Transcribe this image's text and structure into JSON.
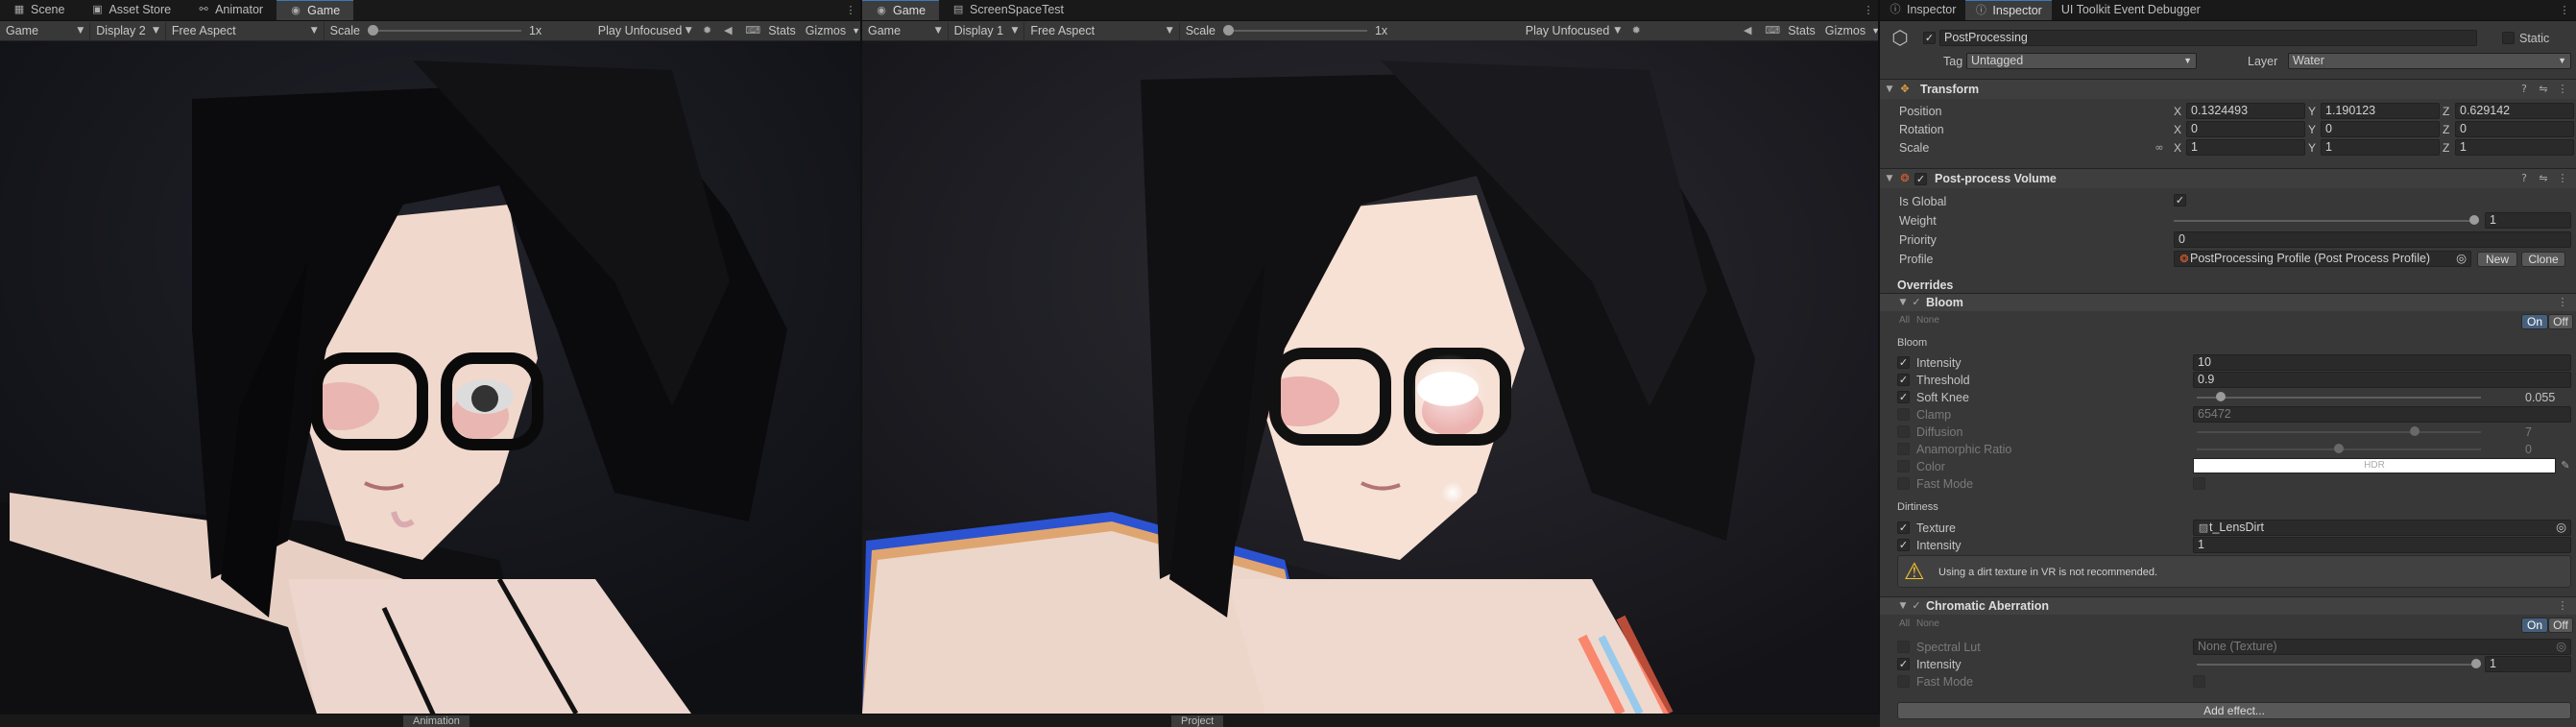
{
  "left_panel": {
    "tabs": [
      {
        "icon": "scene-icon",
        "label": "Scene"
      },
      {
        "icon": "asset-store-icon",
        "label": "Asset Store"
      },
      {
        "icon": "animator-icon",
        "label": "Animator"
      },
      {
        "icon": "game-icon",
        "label": "Game"
      }
    ],
    "toolbar": {
      "mode": "Game",
      "display": "Display 2",
      "aspect": "Free Aspect",
      "scale_label": "Scale",
      "scale_value": "1x",
      "play_mode": "Play Unfocused",
      "stats": "Stats",
      "gizmos": "Gizmos"
    }
  },
  "middle_panel": {
    "tabs": [
      {
        "icon": "game-icon",
        "label": "Game"
      },
      {
        "icon": "screenspace-icon",
        "label": "ScreenSpaceTest"
      }
    ],
    "toolbar": {
      "mode": "Game",
      "display": "Display 1",
      "aspect": "Free Aspect",
      "scale_label": "Scale",
      "scale_value": "1x",
      "play_mode": "Play Unfocused",
      "stats": "Stats",
      "gizmos": "Gizmos"
    }
  },
  "bottom_tabs": [
    "Animation",
    "Project"
  ],
  "inspector": {
    "tabs": [
      "Inspector",
      "Inspector",
      "UI Toolkit Event Debugger"
    ],
    "object": {
      "name": "PostProcessing",
      "static_label": "Static",
      "tag_label": "Tag",
      "tag_value": "Untagged",
      "layer_label": "Layer",
      "layer_value": "Water"
    },
    "transform": {
      "title": "Transform",
      "rows": [
        {
          "label": "Position",
          "x": "0.1324493",
          "y": "1.190123",
          "z": "0.629142"
        },
        {
          "label": "Rotation",
          "x": "0",
          "y": "0",
          "z": "0"
        },
        {
          "label": "Scale",
          "x": "1",
          "y": "1",
          "z": "1"
        }
      ],
      "axis_x": "X",
      "axis_y": "Y",
      "axis_z": "Z"
    },
    "volume": {
      "title": "Post-process Volume",
      "is_global_label": "Is Global",
      "weight_label": "Weight",
      "weight_value": "1",
      "priority_label": "Priority",
      "priority_value": "0",
      "profile_label": "Profile",
      "profile_value": "PostProcessing Profile (Post Process Profile)",
      "new_btn": "New",
      "clone_btn": "Clone",
      "overrides_label": "Overrides"
    },
    "bloom": {
      "title": "Bloom",
      "all": "All",
      "none": "None",
      "on": "On",
      "off": "Off",
      "section_bloom": "Bloom",
      "intensity_label": "Intensity",
      "intensity_value": "10",
      "threshold_label": "Threshold",
      "threshold_value": "0.9",
      "soft_knee_label": "Soft Knee",
      "soft_knee_value": "0.055",
      "clamp_label": "Clamp",
      "clamp_value": "65472",
      "diffusion_label": "Diffusion",
      "diffusion_value": "7",
      "anamorphic_label": "Anamorphic Ratio",
      "anamorphic_value": "0",
      "color_label": "Color",
      "color_hdr": "HDR",
      "fast_mode_label": "Fast Mode",
      "section_dirtiness": "Dirtiness",
      "texture_label": "Texture",
      "texture_value": "t_LensDirt",
      "dirt_intensity_label": "Intensity",
      "dirt_intensity_value": "1",
      "warning": "Using a dirt texture in VR is not recommended."
    },
    "chromatic": {
      "title": "Chromatic Aberration",
      "all": "All",
      "none": "None",
      "on": "On",
      "off": "Off",
      "spectral_label": "Spectral Lut",
      "spectral_value": "None (Texture)",
      "intensity_label": "Intensity",
      "intensity_value": "1",
      "fast_mode_label": "Fast Mode"
    },
    "add_effect": "Add effect..."
  }
}
